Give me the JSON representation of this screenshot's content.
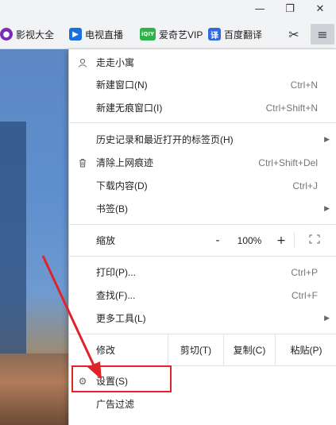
{
  "window": {
    "minimize_glyph": "—",
    "maximize_glyph": "❐",
    "close_glyph": "✕"
  },
  "bookmarks": [
    {
      "label": "影视大全",
      "icon": "film-reel-icon",
      "color": "#7a2bb8"
    },
    {
      "label": "电视直播",
      "icon": "tv-play-icon",
      "color": "#1a6fe0"
    },
    {
      "label": "爱奇艺VIP",
      "icon_text": "iQIY",
      "icon": "iqiyi-icon",
      "color": "#2cb34a"
    },
    {
      "label": "百度翻译",
      "icon_text": "译",
      "icon": "translate-icon",
      "color": "#2f6be0"
    }
  ],
  "toolbar": {
    "cut_icon": "scissors-icon",
    "menu_icon": "hamburger-menu-icon"
  },
  "menu": {
    "user": {
      "label": "走走小寓",
      "icon": "user-icon"
    },
    "new_window": {
      "label": "新建窗口(N)",
      "shortcut": "Ctrl+N"
    },
    "new_incognito": {
      "label": "新建无痕窗口(I)",
      "shortcut": "Ctrl+Shift+N"
    },
    "history": {
      "label": "历史记录和最近打开的标签页(H)",
      "has_submenu": true
    },
    "clear": {
      "label": "清除上网痕迹",
      "shortcut": "Ctrl+Shift+Del",
      "icon": "trash-icon"
    },
    "downloads": {
      "label": "下载内容(D)",
      "shortcut": "Ctrl+J"
    },
    "bookmarks": {
      "label": "书签(B)",
      "has_submenu": true
    },
    "zoom": {
      "label": "缩放",
      "minus": "-",
      "value": "100%",
      "plus": "+",
      "fullscreen_icon": "fullscreen-icon"
    },
    "print": {
      "label": "打印(P)...",
      "shortcut": "Ctrl+P"
    },
    "find": {
      "label": "查找(F)...",
      "shortcut": "Ctrl+F"
    },
    "more_tools": {
      "label": "更多工具(L)",
      "has_submenu": true
    },
    "edit": {
      "label": "修改",
      "cut": "剪切(T)",
      "copy": "复制(C)",
      "paste": "粘贴(P)"
    },
    "settings": {
      "label": "设置(S)",
      "icon": "gear-icon"
    },
    "adblock": {
      "label": "广告过滤"
    }
  },
  "annotation": {
    "color": "#e0232a"
  }
}
